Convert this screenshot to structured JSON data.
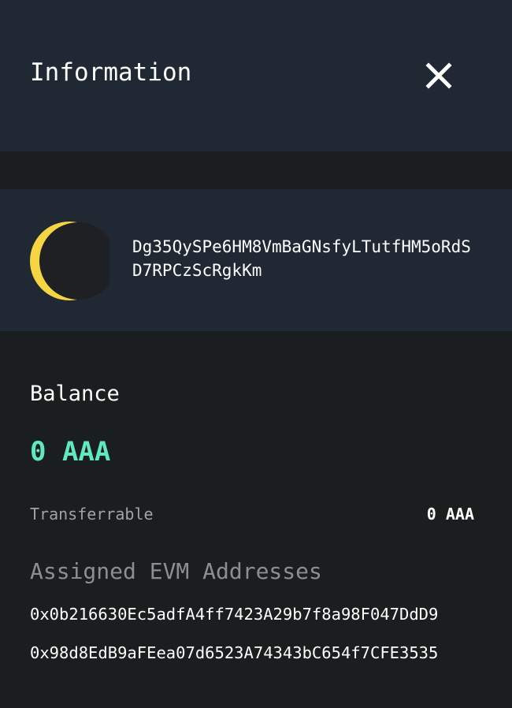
{
  "header": {
    "title": "Information",
    "close_icon": "close-icon"
  },
  "account": {
    "avatar_icon": "crescent-moon-icon",
    "address": "Dg35QySPe6HM8VmBaGNsfyLTutfHM5oRdSD7RPCzScRgkKm"
  },
  "balance": {
    "label": "Balance",
    "value": "0 AAA",
    "accent_color": "#5eeabc"
  },
  "transferrable": {
    "label": "Transferrable",
    "value": "0 AAA"
  },
  "evm": {
    "heading": "Assigned EVM Addresses",
    "addresses": [
      "0x0b216630Ec5adfA4ff7423A29b7f8a98F047DdD9",
      "0x98d8EdB9aFEea07d6523A74343bC654f7CFE3535"
    ]
  }
}
